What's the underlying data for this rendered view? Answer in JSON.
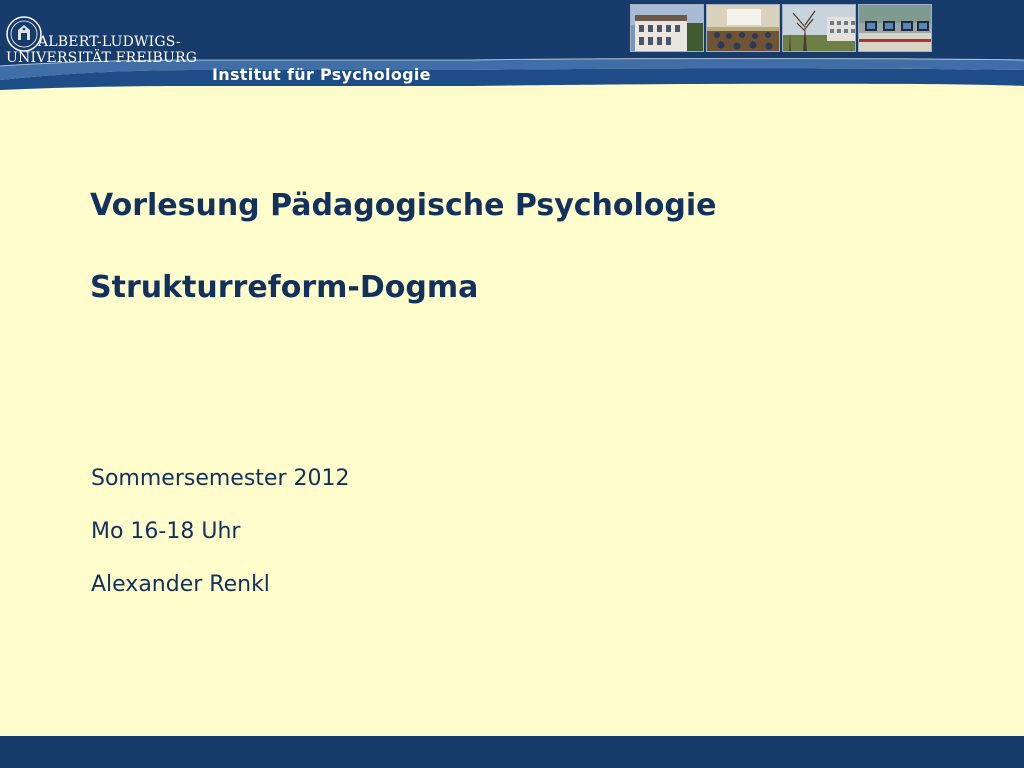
{
  "header": {
    "university_line1": "ALBERT-LUDWIGS-",
    "university_line2": "UNIVERSITÄT FREIBURG",
    "institute": "Institut für Psychologie",
    "logo_icon": "university-seal-icon",
    "photos": [
      "building-photo",
      "lecture-hall-photo",
      "campus-trees-photo",
      "computer-lab-photo"
    ]
  },
  "slide": {
    "title": "Vorlesung Pädagogische Psychologie",
    "subtitle": "Strukturreform-Dogma",
    "semester": "Sommersemester 2012",
    "time": "Mo 16-18 Uhr",
    "lecturer": "Alexander Renkl"
  },
  "colors": {
    "background": "#FEFDCB",
    "header_band": "#173B6A",
    "header_stripe": "#3F6FA6",
    "text": "#13315F"
  }
}
